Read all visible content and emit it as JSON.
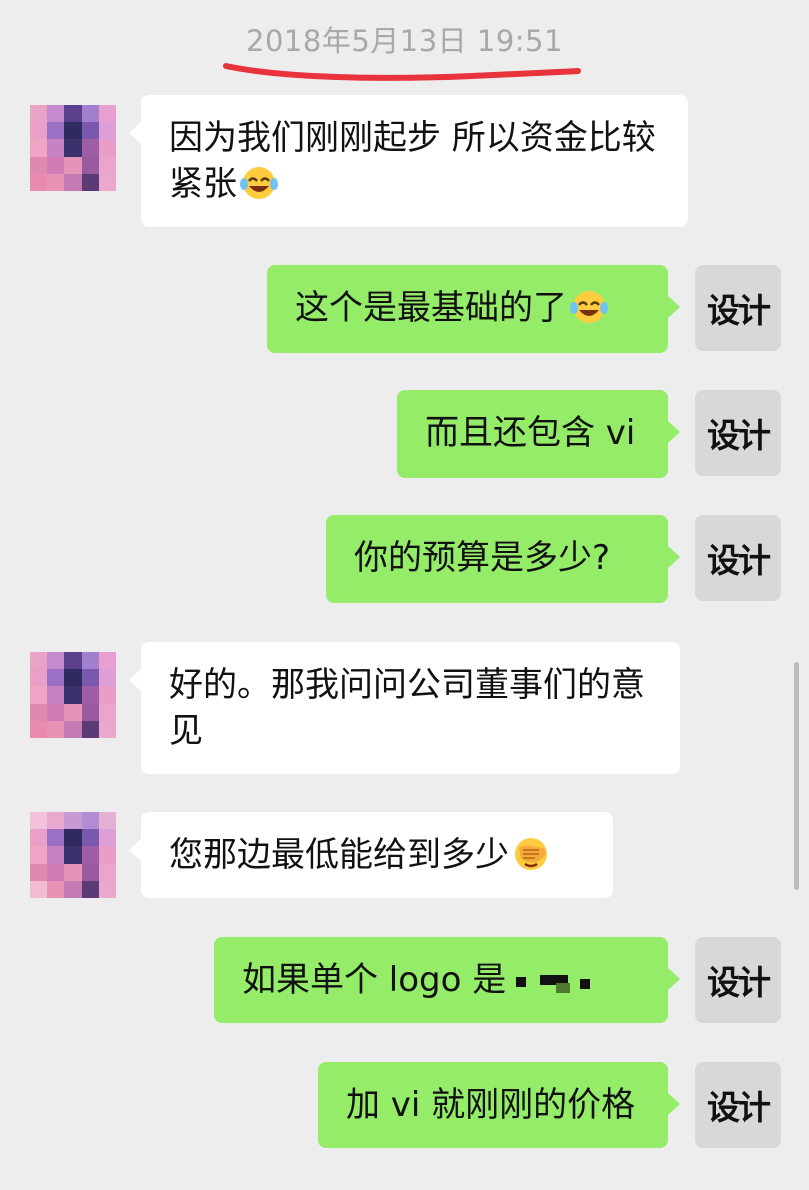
{
  "chat": {
    "timestamp": "2018年5月13日 19:51",
    "self_avatar_text": "设计",
    "messages": [
      {
        "from": "other",
        "text": "因为我们刚刚起步 所以资金比较紧张",
        "emoji": "laughing-tears"
      },
      {
        "from": "self",
        "text": "这个是最基础的了",
        "emoji": "laughing-tears"
      },
      {
        "from": "self",
        "text": "而且还包含 vi"
      },
      {
        "from": "self",
        "text": "你的预算是多少?"
      },
      {
        "from": "other",
        "text": "好的。那我问问公司董事们的意见"
      },
      {
        "from": "other",
        "text": "您那边最低能给到多少",
        "emoji": "facepalm"
      },
      {
        "from": "self",
        "text": "如果单个 logo 是",
        "redacted_value": true
      },
      {
        "from": "self",
        "text": "加 vi 就刚刚的价格"
      }
    ]
  },
  "colors": {
    "background": "#ededed",
    "incoming_bubble": "#ffffff",
    "outgoing_bubble": "#95ec69",
    "timestamp_text": "#a8a8a8",
    "annotation_red": "#e8323c"
  }
}
